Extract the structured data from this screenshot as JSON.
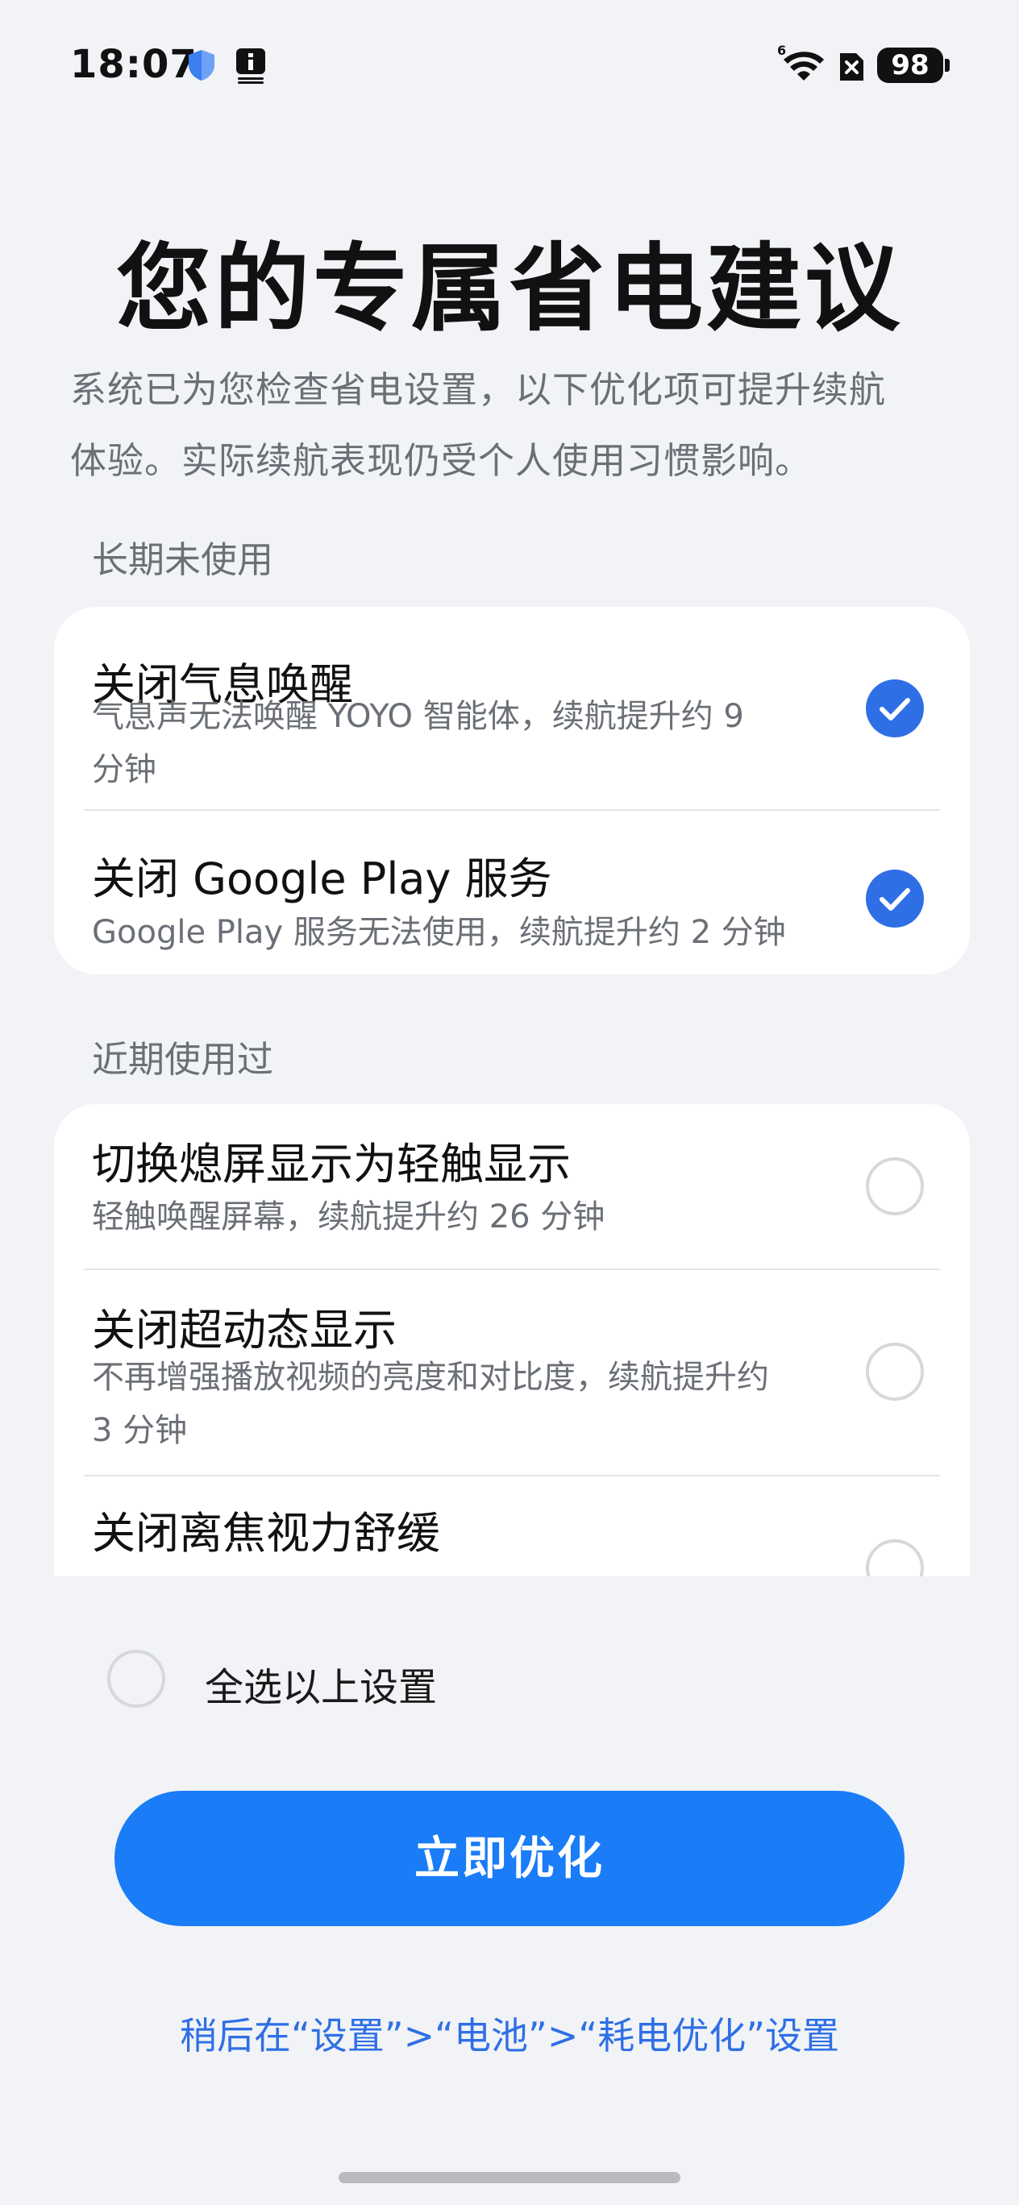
{
  "status_bar": {
    "time": "18:07",
    "battery_level": "98",
    "network_badge": "6",
    "icons": [
      "shield-icon",
      "notification-icon",
      "wifi-icon",
      "sim-off-icon",
      "battery-icon"
    ]
  },
  "page": {
    "title": "您的专属省电建议",
    "description_line1": "系统已为您检查省电设置，以下优化项可提升续航",
    "description_line2": "体验。实际续航表现仍受个人使用习惯影响。"
  },
  "sections": [
    {
      "label": "长期未使用",
      "items": [
        {
          "title": "关闭气息唤醒",
          "subtitle_line1": "气息声无法唤醒 YOYO 智能体，续航提升约 9",
          "subtitle_line2": "分钟",
          "checked": true
        },
        {
          "title": "关闭 Google Play 服务",
          "subtitle_line1": "Google Play 服务无法使用，续航提升约 2 分钟",
          "checked": true
        }
      ]
    },
    {
      "label": "近期使用过",
      "items": [
        {
          "title": "切换熄屏显示为轻触显示",
          "subtitle_line1": "轻触唤醒屏幕，续航提升约 26 分钟",
          "checked": false
        },
        {
          "title": "关闭超动态显示",
          "subtitle_line1": "不再增强播放视频的亮度和对比度，续航提升约",
          "subtitle_line2": "3 分钟",
          "checked": false
        },
        {
          "title": "关闭离焦视力舒缓",
          "checked": false
        }
      ]
    }
  ],
  "select_all": {
    "label": "全选以上设置",
    "checked": false
  },
  "primary_button": {
    "label": "立即优化"
  },
  "footer_link": {
    "label": "稍后在“设置”>“电池”>“耗电优化”设置"
  },
  "colors": {
    "background": "#f1f3f6",
    "accent": "#2f6fe6",
    "button": "#1a7cf7"
  }
}
